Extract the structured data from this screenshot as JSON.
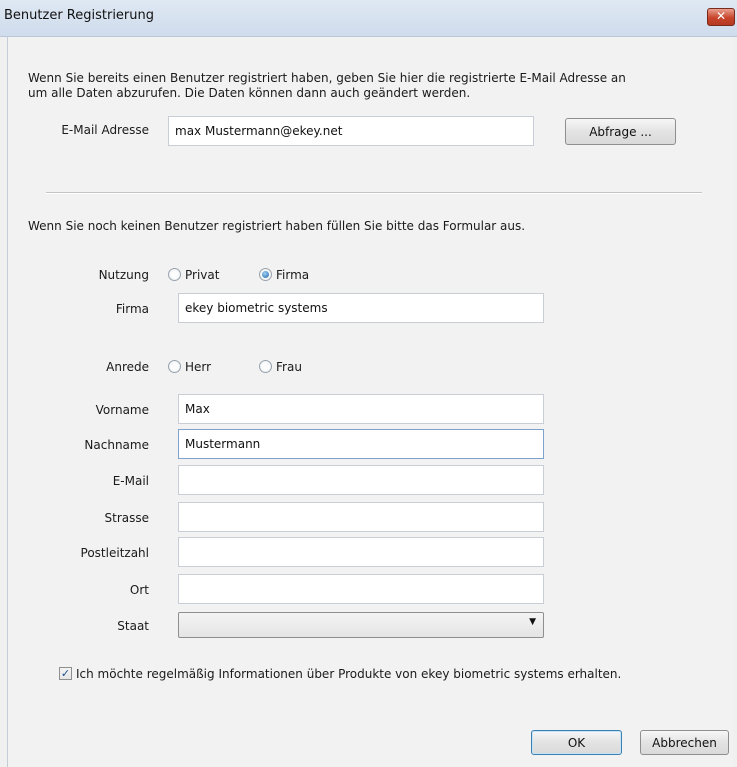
{
  "window": {
    "title": "Benutzer Registrierung",
    "close_glyph": "✕"
  },
  "lookup": {
    "intro_line1": "Wenn Sie bereits einen Benutzer registriert haben, geben Sie hier die registrierte E-Mail Adresse an",
    "intro_line2": "um alle Daten abzurufen. Die Daten können dann auch geändert werden.",
    "email_label": "E-Mail Adresse",
    "email_value": "max Mustermann@ekey.net",
    "query_button": "Abfrage ..."
  },
  "form": {
    "intro": "Wenn Sie noch keinen Benutzer registriert haben füllen Sie bitte das Formular aus.",
    "usage": {
      "label": "Nutzung",
      "options": [
        "Privat",
        "Firma"
      ],
      "selected": "Firma"
    },
    "company": {
      "label": "Firma",
      "value": "ekey biometric systems"
    },
    "salutation": {
      "label": "Anrede",
      "options": [
        "Herr",
        "Frau"
      ],
      "selected": ""
    },
    "first_name": {
      "label": "Vorname",
      "value": "Max"
    },
    "last_name": {
      "label": "Nachname",
      "value": "Mustermann"
    },
    "email": {
      "label": "E-Mail",
      "value": ""
    },
    "street": {
      "label": "Strasse",
      "value": ""
    },
    "postal_code": {
      "label": "Postleitzahl",
      "value": ""
    },
    "city": {
      "label": "Ort",
      "value": ""
    },
    "country": {
      "label": "Staat",
      "value": ""
    }
  },
  "newsletter": {
    "checked": true,
    "check_glyph": "✓",
    "label": "Ich möchte regelmäßig Informationen über Produkte von ekey biometric systems erhalten."
  },
  "footer": {
    "ok_label": "OK",
    "cancel_label": "Abbrechen"
  },
  "icons": {
    "dropdown": "▼"
  }
}
